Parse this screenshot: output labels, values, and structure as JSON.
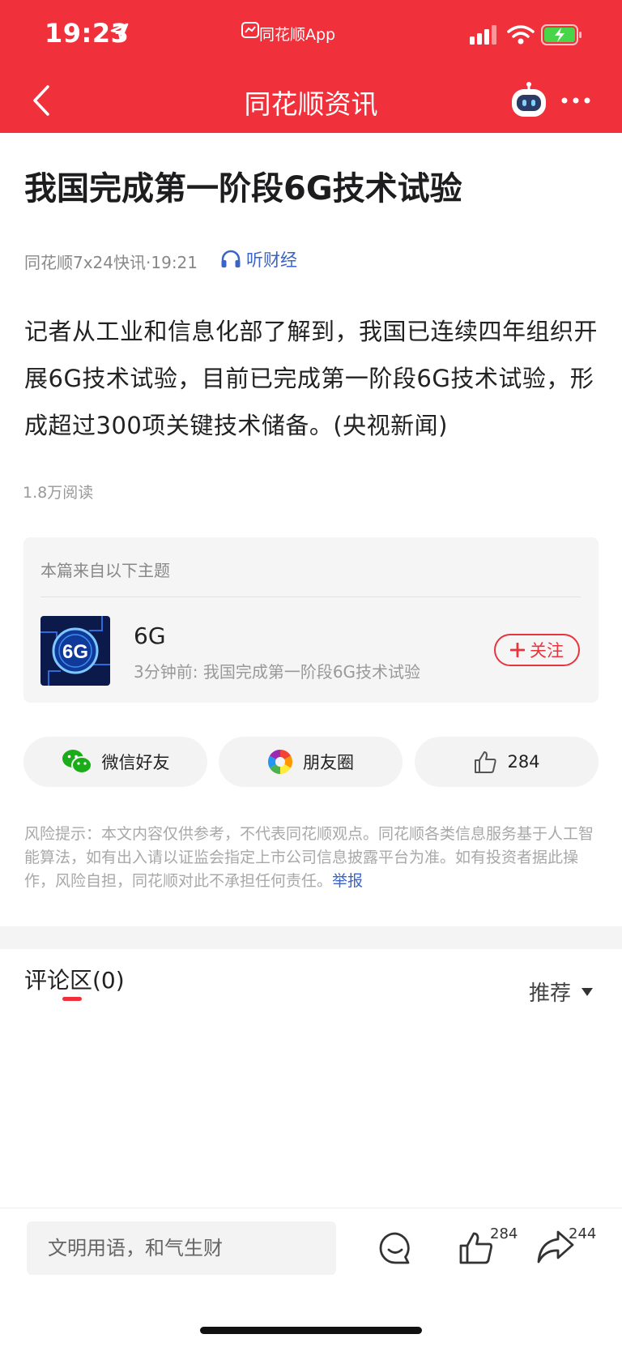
{
  "status_bar": {
    "time": "19:23",
    "app_label": "同花顺App"
  },
  "nav": {
    "title": "同花顺资讯"
  },
  "article": {
    "title": "我国完成第一阶段6G技术试验",
    "source_time": "同花顺7x24快讯·19:21",
    "listen_label": "听财经",
    "body": "记者从工业和信息化部了解到，我国已连续四年组织开展6G技术试验，目前已完成第一阶段6G技术试验，形成超过300项关键技术储备。(央视新闻)",
    "reads": "1.8万阅读"
  },
  "topic": {
    "header": "本篇来自以下主题",
    "image_text": "6G",
    "name": "6G",
    "latest": "3分钟前: 我国完成第一阶段6G技术试验",
    "follow_label": "关注"
  },
  "share": {
    "wechat_label": "微信好友",
    "moments_label": "朋友圈",
    "likes_count": "284"
  },
  "risk": {
    "text": "风险提示：本文内容仅供参考，不代表同花顺观点。同花顺各类信息服务基于人工智能算法，如有出入请以证监会指定上市公司信息披露平台为准。如有投资者据此操作，风险自担，同花顺对此不承担任何责任。",
    "report_label": "举报"
  },
  "comments": {
    "title": "评论区(0)",
    "sort_label": "推荐"
  },
  "bottom_bar": {
    "input_placeholder": "文明用语，和气生财",
    "like_count": "284",
    "share_count": "244"
  },
  "colors": {
    "brand_red": "#f0303a",
    "link_blue": "#3a64c8",
    "wechat_green": "#1aad19"
  },
  "icons": [
    "location-arrow-icon",
    "cellular-icon",
    "wifi-icon",
    "battery-charging-icon",
    "back-arrow-icon",
    "robot-assistant-icon",
    "more-dots-icon",
    "headphones-icon",
    "plus-icon",
    "wechat-icon",
    "moments-icon",
    "thumbs-up-icon",
    "dropdown-caret-icon",
    "comment-bubble-icon",
    "share-arrow-icon"
  ]
}
